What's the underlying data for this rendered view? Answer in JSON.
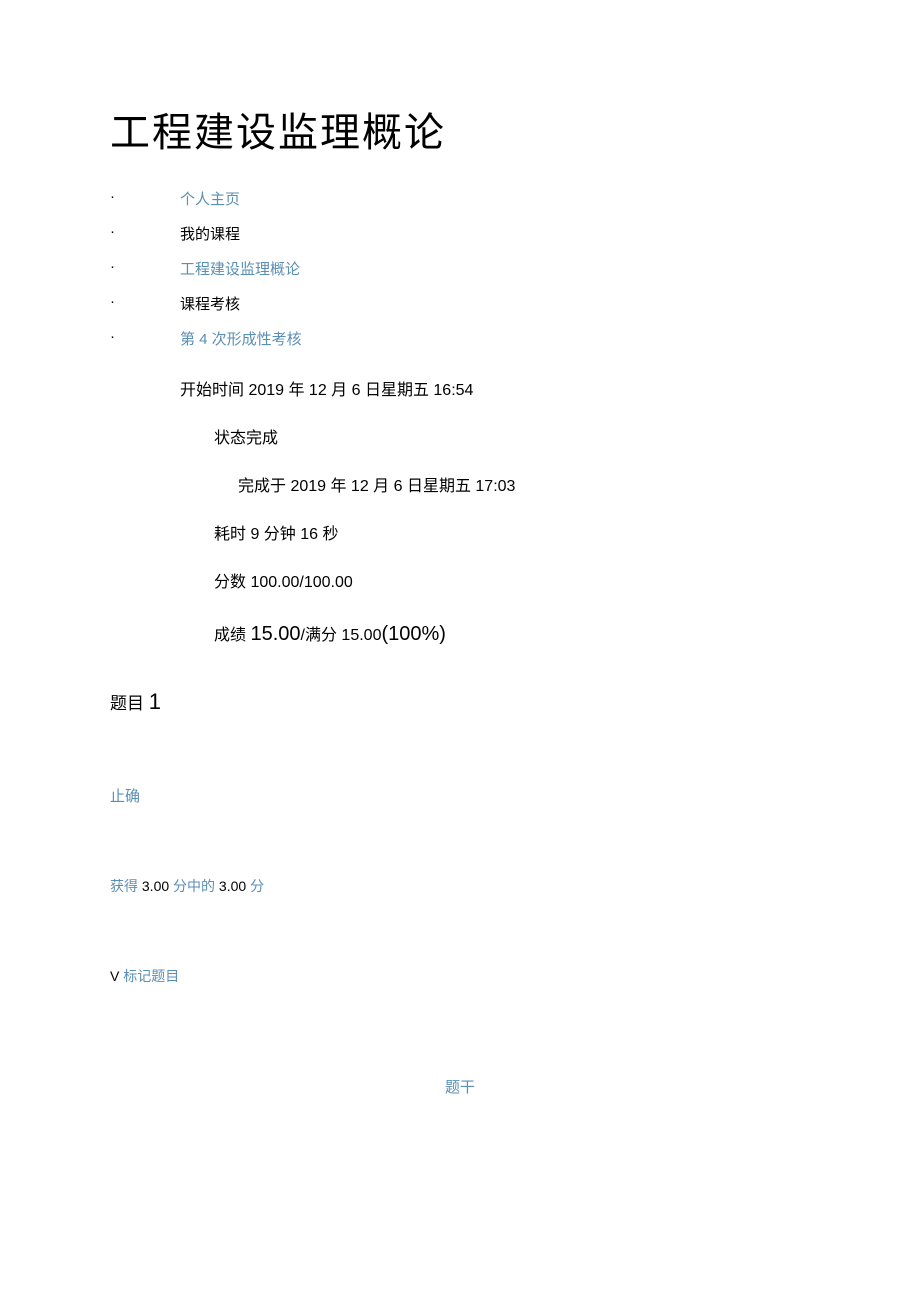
{
  "title": "工程建设监理概论",
  "breadcrumb": [
    {
      "label": "个人主页",
      "link": true
    },
    {
      "label": "我的课程",
      "link": false
    },
    {
      "label": "工程建设监理概论",
      "link": true
    },
    {
      "label": "课程考核",
      "link": false
    },
    {
      "label": "第 4 次形成性考核",
      "link": true
    }
  ],
  "info": {
    "start_time": "开始时间 2019 年 12 月 6 日星期五 16:54",
    "status": "状态完成",
    "completed_at": "完成于 2019 年 12 月 6 日星期五 17:03",
    "duration": "耗时 9 分钟 16 秒",
    "score": "分数 100.00/100.00",
    "grade_label": "成绩",
    "grade_value": "15.00",
    "grade_sep": "/满分 15.00",
    "grade_pct": "(100%)"
  },
  "question": {
    "label": "题目",
    "number": "1",
    "status": "止确",
    "score_text_prefix": "获得 ",
    "score_a": "3.00 ",
    "score_mid": "分中的 ",
    "score_b": "3.00 ",
    "score_suffix": "分",
    "flag_v": "V",
    "flag_text": "标记题目",
    "stem": "题干"
  }
}
